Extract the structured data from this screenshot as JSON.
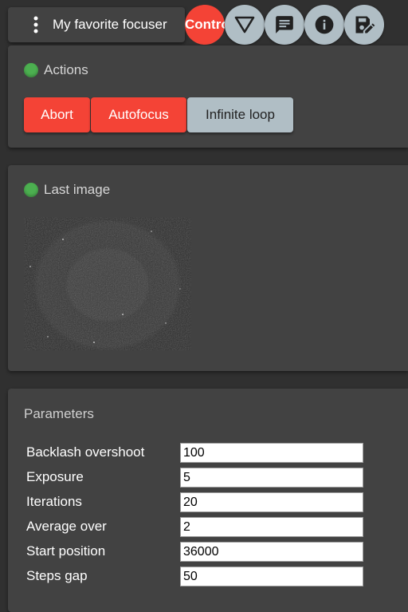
{
  "header": {
    "title": "My favorite focuser",
    "active_tab_label": "Control",
    "menu_icon": "more-vert-icon",
    "buttons": [
      {
        "name": "filter-button",
        "icon": "filter-triangle-icon"
      },
      {
        "name": "messages-button",
        "icon": "chat-icon"
      },
      {
        "name": "info-button",
        "icon": "info-icon"
      },
      {
        "name": "save-edit-button",
        "icon": "save-edit-icon"
      }
    ]
  },
  "actions": {
    "title": "Actions",
    "status": "ok",
    "buttons": {
      "abort": "Abort",
      "autofocus": "Autofocus",
      "infinite_loop": "Infinite loop"
    }
  },
  "last_image": {
    "title": "Last image",
    "status": "ok"
  },
  "parameters": {
    "title": "Parameters",
    "rows": [
      {
        "label": "Backlash overshoot",
        "value": "100"
      },
      {
        "label": "Exposure",
        "value": "5"
      },
      {
        "label": "Iterations",
        "value": "20"
      },
      {
        "label": "Average over",
        "value": "2"
      },
      {
        "label": "Start position",
        "value": "36000"
      },
      {
        "label": "Steps gap",
        "value": "50"
      }
    ]
  },
  "colors": {
    "background": "#303030",
    "card": "#424242",
    "accent_red": "#f44336",
    "accent_grey": "#b0bec5",
    "status_green": "#4caf50"
  }
}
